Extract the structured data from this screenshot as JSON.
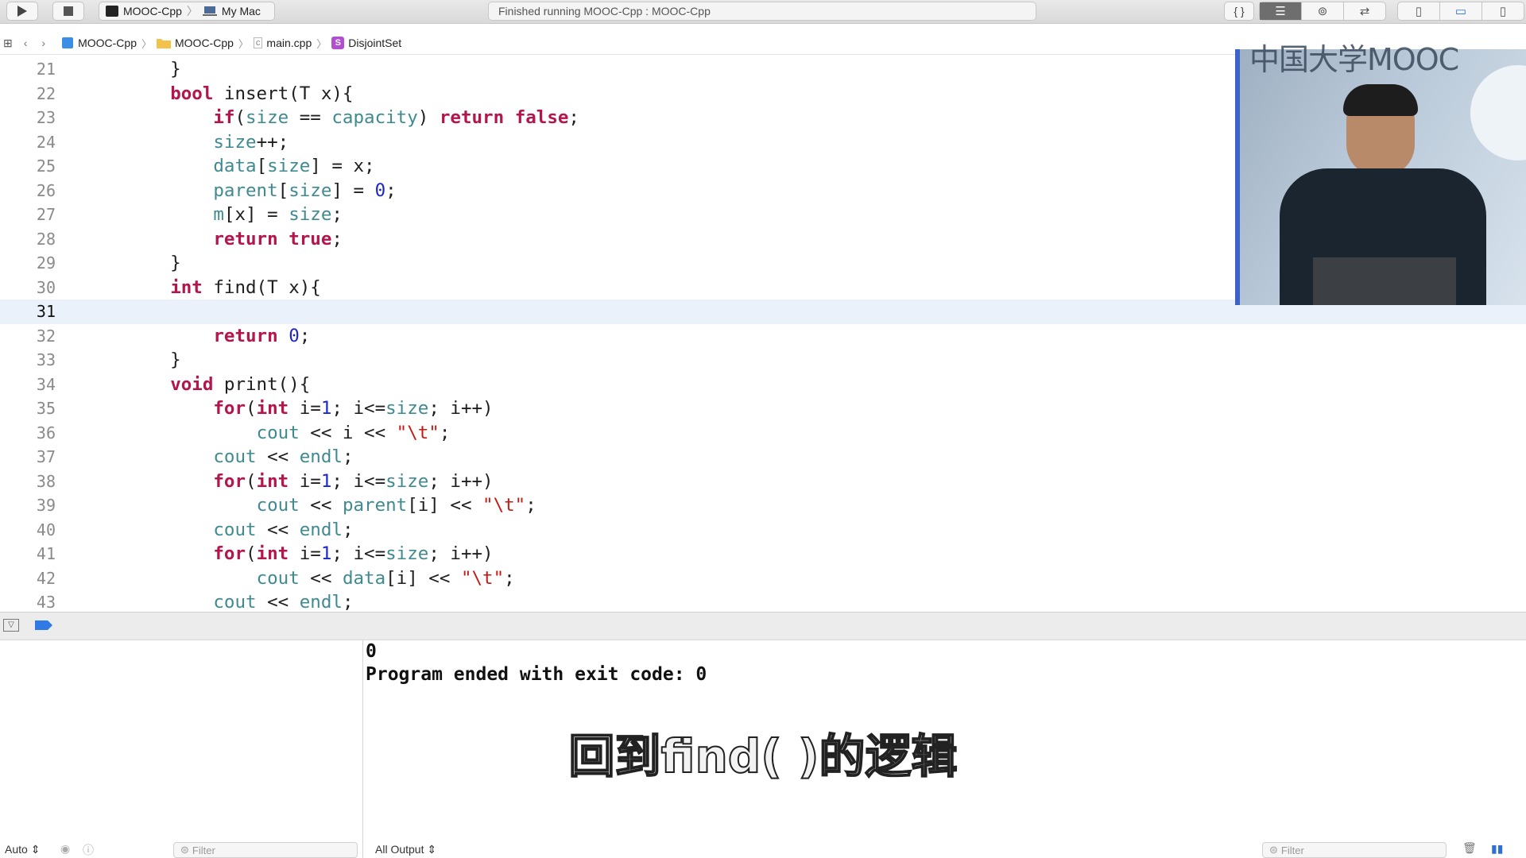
{
  "toolbar": {
    "run_icon": "play-icon",
    "stop_icon": "stop-icon",
    "scheme_name": "MOOC-Cpp",
    "destination": "My Mac",
    "activity": "Finished running MOOC-Cpp : MOOC-Cpp",
    "editor_icons": [
      "braces-icon",
      "standard-editor-icon",
      "assistant-editor-icon",
      "version-editor-icon"
    ],
    "panel_icons": [
      "navigator-toggle-icon",
      "debug-area-toggle-icon",
      "inspector-toggle-icon"
    ]
  },
  "jumpbar": {
    "project": "MOOC-Cpp",
    "group": "MOOC-Cpp",
    "file": "main.cpp",
    "symbol_badge": "S",
    "symbol": "DisjointSet"
  },
  "editor": {
    "current_line": "31",
    "lines": [
      {
        "n": "21",
        "code": "    }"
      },
      {
        "n": "22",
        "code": "    bool insert(T x){"
      },
      {
        "n": "23",
        "code": "        if(size == capacity) return false;"
      },
      {
        "n": "24",
        "code": "        size++;"
      },
      {
        "n": "25",
        "code": "        data[size] = x;"
      },
      {
        "n": "26",
        "code": "        parent[size] = 0;"
      },
      {
        "n": "27",
        "code": "        m[x] = size;"
      },
      {
        "n": "28",
        "code": "        return true;"
      },
      {
        "n": "29",
        "code": "    }"
      },
      {
        "n": "30",
        "code": "    int find(T x){"
      },
      {
        "n": "31",
        "code": ""
      },
      {
        "n": "32",
        "code": "        return 0;"
      },
      {
        "n": "33",
        "code": "    }"
      },
      {
        "n": "34",
        "code": "    void print(){"
      },
      {
        "n": "35",
        "code": "        for(int i=1; i<=size; i++)"
      },
      {
        "n": "36",
        "code": "            cout << i << \"\\t\";"
      },
      {
        "n": "37",
        "code": "        cout << endl;"
      },
      {
        "n": "38",
        "code": "        for(int i=1; i<=size; i++)"
      },
      {
        "n": "39",
        "code": "            cout << parent[i] << \"\\t\";"
      },
      {
        "n": "40",
        "code": "        cout << endl;"
      },
      {
        "n": "41",
        "code": "        for(int i=1; i<=size; i++)"
      },
      {
        "n": "42",
        "code": "            cout << data[i] << \"\\t\";"
      },
      {
        "n": "43",
        "code": "        cout << endl;"
      }
    ]
  },
  "watermark": "中国大学MOOC",
  "console": {
    "lines": [
      "0",
      "Program ended with exit code: 0"
    ]
  },
  "subtitle": "回到find( )的逻辑",
  "bottom": {
    "auto_label": "Auto",
    "filter_placeholder_left": "Filter",
    "output_select": "All Output",
    "filter_placeholder_right": "Filter"
  },
  "colors": {
    "keyword": "#b3154c",
    "member": "#3f8a90",
    "number": "#1c26c9",
    "string": "#c41a16",
    "current_line_bg": "#eaf1fb"
  }
}
